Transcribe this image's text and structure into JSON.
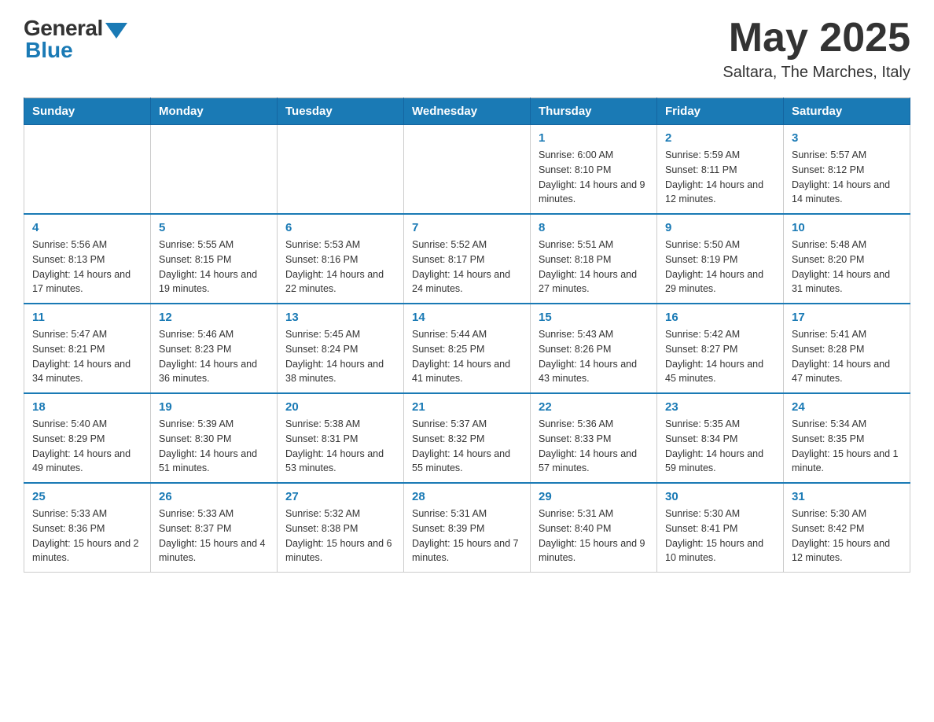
{
  "header": {
    "logo": {
      "general": "General",
      "blue": "Blue"
    },
    "title": "May 2025",
    "location": "Saltara, The Marches, Italy"
  },
  "calendar": {
    "days_of_week": [
      "Sunday",
      "Monday",
      "Tuesday",
      "Wednesday",
      "Thursday",
      "Friday",
      "Saturday"
    ],
    "weeks": [
      {
        "days": [
          {
            "number": "",
            "info": ""
          },
          {
            "number": "",
            "info": ""
          },
          {
            "number": "",
            "info": ""
          },
          {
            "number": "",
            "info": ""
          },
          {
            "number": "1",
            "info": "Sunrise: 6:00 AM\nSunset: 8:10 PM\nDaylight: 14 hours and 9 minutes."
          },
          {
            "number": "2",
            "info": "Sunrise: 5:59 AM\nSunset: 8:11 PM\nDaylight: 14 hours and 12 minutes."
          },
          {
            "number": "3",
            "info": "Sunrise: 5:57 AM\nSunset: 8:12 PM\nDaylight: 14 hours and 14 minutes."
          }
        ]
      },
      {
        "days": [
          {
            "number": "4",
            "info": "Sunrise: 5:56 AM\nSunset: 8:13 PM\nDaylight: 14 hours and 17 minutes."
          },
          {
            "number": "5",
            "info": "Sunrise: 5:55 AM\nSunset: 8:15 PM\nDaylight: 14 hours and 19 minutes."
          },
          {
            "number": "6",
            "info": "Sunrise: 5:53 AM\nSunset: 8:16 PM\nDaylight: 14 hours and 22 minutes."
          },
          {
            "number": "7",
            "info": "Sunrise: 5:52 AM\nSunset: 8:17 PM\nDaylight: 14 hours and 24 minutes."
          },
          {
            "number": "8",
            "info": "Sunrise: 5:51 AM\nSunset: 8:18 PM\nDaylight: 14 hours and 27 minutes."
          },
          {
            "number": "9",
            "info": "Sunrise: 5:50 AM\nSunset: 8:19 PM\nDaylight: 14 hours and 29 minutes."
          },
          {
            "number": "10",
            "info": "Sunrise: 5:48 AM\nSunset: 8:20 PM\nDaylight: 14 hours and 31 minutes."
          }
        ]
      },
      {
        "days": [
          {
            "number": "11",
            "info": "Sunrise: 5:47 AM\nSunset: 8:21 PM\nDaylight: 14 hours and 34 minutes."
          },
          {
            "number": "12",
            "info": "Sunrise: 5:46 AM\nSunset: 8:23 PM\nDaylight: 14 hours and 36 minutes."
          },
          {
            "number": "13",
            "info": "Sunrise: 5:45 AM\nSunset: 8:24 PM\nDaylight: 14 hours and 38 minutes."
          },
          {
            "number": "14",
            "info": "Sunrise: 5:44 AM\nSunset: 8:25 PM\nDaylight: 14 hours and 41 minutes."
          },
          {
            "number": "15",
            "info": "Sunrise: 5:43 AM\nSunset: 8:26 PM\nDaylight: 14 hours and 43 minutes."
          },
          {
            "number": "16",
            "info": "Sunrise: 5:42 AM\nSunset: 8:27 PM\nDaylight: 14 hours and 45 minutes."
          },
          {
            "number": "17",
            "info": "Sunrise: 5:41 AM\nSunset: 8:28 PM\nDaylight: 14 hours and 47 minutes."
          }
        ]
      },
      {
        "days": [
          {
            "number": "18",
            "info": "Sunrise: 5:40 AM\nSunset: 8:29 PM\nDaylight: 14 hours and 49 minutes."
          },
          {
            "number": "19",
            "info": "Sunrise: 5:39 AM\nSunset: 8:30 PM\nDaylight: 14 hours and 51 minutes."
          },
          {
            "number": "20",
            "info": "Sunrise: 5:38 AM\nSunset: 8:31 PM\nDaylight: 14 hours and 53 minutes."
          },
          {
            "number": "21",
            "info": "Sunrise: 5:37 AM\nSunset: 8:32 PM\nDaylight: 14 hours and 55 minutes."
          },
          {
            "number": "22",
            "info": "Sunrise: 5:36 AM\nSunset: 8:33 PM\nDaylight: 14 hours and 57 minutes."
          },
          {
            "number": "23",
            "info": "Sunrise: 5:35 AM\nSunset: 8:34 PM\nDaylight: 14 hours and 59 minutes."
          },
          {
            "number": "24",
            "info": "Sunrise: 5:34 AM\nSunset: 8:35 PM\nDaylight: 15 hours and 1 minute."
          }
        ]
      },
      {
        "days": [
          {
            "number": "25",
            "info": "Sunrise: 5:33 AM\nSunset: 8:36 PM\nDaylight: 15 hours and 2 minutes."
          },
          {
            "number": "26",
            "info": "Sunrise: 5:33 AM\nSunset: 8:37 PM\nDaylight: 15 hours and 4 minutes."
          },
          {
            "number": "27",
            "info": "Sunrise: 5:32 AM\nSunset: 8:38 PM\nDaylight: 15 hours and 6 minutes."
          },
          {
            "number": "28",
            "info": "Sunrise: 5:31 AM\nSunset: 8:39 PM\nDaylight: 15 hours and 7 minutes."
          },
          {
            "number": "29",
            "info": "Sunrise: 5:31 AM\nSunset: 8:40 PM\nDaylight: 15 hours and 9 minutes."
          },
          {
            "number": "30",
            "info": "Sunrise: 5:30 AM\nSunset: 8:41 PM\nDaylight: 15 hours and 10 minutes."
          },
          {
            "number": "31",
            "info": "Sunrise: 5:30 AM\nSunset: 8:42 PM\nDaylight: 15 hours and 12 minutes."
          }
        ]
      }
    ]
  }
}
